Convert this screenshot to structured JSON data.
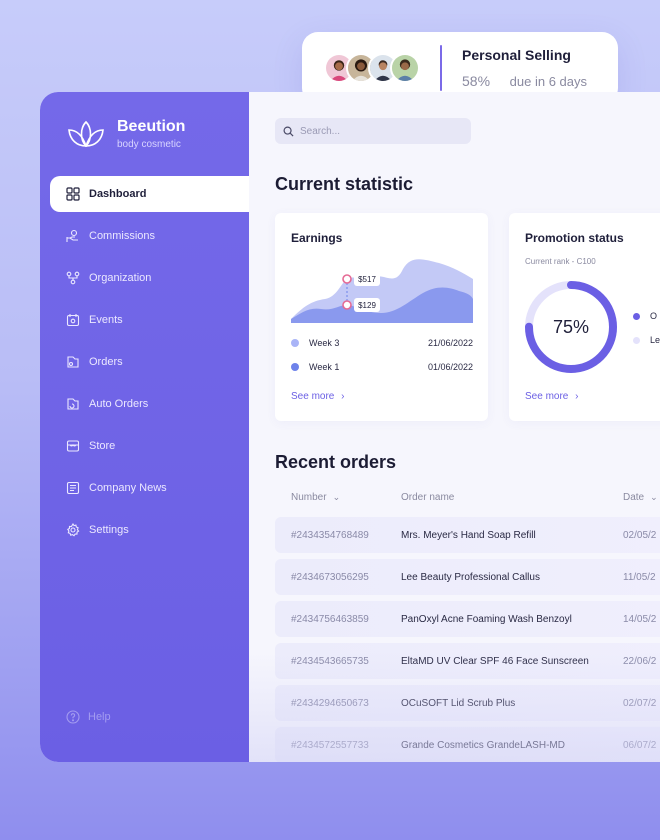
{
  "top_card": {
    "title": "Personal Selling",
    "percent": "58%",
    "due": "due in 6 days",
    "avatars": [
      "avatar-1",
      "avatar-2",
      "avatar-3",
      "avatar-4"
    ]
  },
  "brand": {
    "name": "Beeution",
    "tagline": "body cosmetic"
  },
  "sidebar": {
    "items": [
      {
        "label": "Dashboard",
        "icon": "grid-icon",
        "active": true
      },
      {
        "label": "Commissions",
        "icon": "hand-coin-icon"
      },
      {
        "label": "Organization",
        "icon": "org-icon"
      },
      {
        "label": "Events",
        "icon": "calendar-icon"
      },
      {
        "label": "Orders",
        "icon": "orders-icon"
      },
      {
        "label": "Auto Orders",
        "icon": "auto-orders-icon"
      },
      {
        "label": "Store",
        "icon": "store-icon"
      },
      {
        "label": "Company News",
        "icon": "news-icon"
      },
      {
        "label": "Settings",
        "icon": "gear-icon"
      }
    ],
    "help": "Help"
  },
  "search": {
    "placeholder": "Search..."
  },
  "current_statistic": {
    "title": "Current statistic",
    "earnings": {
      "title": "Earnings",
      "point_top": "$517",
      "point_bottom": "$129",
      "legend": [
        {
          "label": "Week 3",
          "date": "21/06/2022",
          "color": "#a9b4f7"
        },
        {
          "label": "Week 1",
          "date": "01/06/2022",
          "color": "#6e82ea"
        }
      ],
      "see_more": "See more"
    },
    "promotion": {
      "title": "Promotion status",
      "subtitle": "Current rank - C100",
      "percent": "75%",
      "progress": 0.75,
      "legend": [
        {
          "label": "O",
          "color": "#6b5fe4"
        },
        {
          "label": "Le",
          "color": "#e4e2fb"
        }
      ],
      "see_more": "See more"
    }
  },
  "recent_orders": {
    "title": "Recent orders",
    "columns": [
      "Number",
      "Order name",
      "Date"
    ],
    "rows": [
      {
        "number": "#2434354768489",
        "name": "Mrs. Meyer's Hand Soap Refill",
        "date": "02/05/2"
      },
      {
        "number": "#2434673056295",
        "name": "Lee Beauty Professional Callus",
        "date": "11/05/2"
      },
      {
        "number": "#2434756463859",
        "name": "PanOxyl Acne Foaming Wash Benzoyl",
        "date": "14/05/2"
      },
      {
        "number": "#2434543665735",
        "name": "EltaMD UV Clear SPF 46 Face Sunscreen",
        "date": "22/06/2"
      },
      {
        "number": "#2434294650673",
        "name": "OCuSOFT Lid Scrub Plus",
        "date": "02/07/2"
      },
      {
        "number": "#2434572557733",
        "name": "Grande Cosmetics GrandeLASH-MD",
        "date": "06/07/2"
      }
    ]
  }
}
